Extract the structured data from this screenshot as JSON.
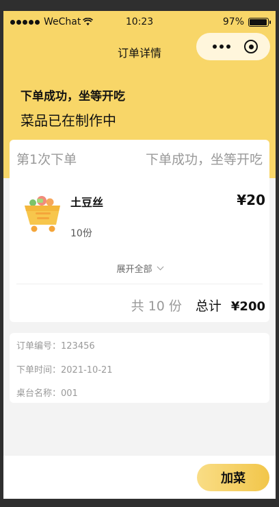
{
  "status_bar": {
    "carrier": "WeChat",
    "time": "10:23",
    "battery_text": "97%",
    "battery_level": 0.97
  },
  "nav": {
    "title": "订单详情",
    "more_icon": "more-dots-icon",
    "close_icon": "target-circle-icon"
  },
  "header": {
    "status": "下单成功，坐等开吃",
    "substatus": "菜品已在制作中"
  },
  "order_card": {
    "batch_label": "第1次下单",
    "batch_status": "下单成功，坐等开吃",
    "items": [
      {
        "name": "土豆丝",
        "quantity": "10份",
        "price": "¥20",
        "icon": "shopping-cart-icon"
      }
    ],
    "expand_label": "展开全部",
    "total_count": "共 10 份",
    "total_label": "总计",
    "total_value": "¥200"
  },
  "info": {
    "order_no": "订单编号：123456",
    "order_time": "下单时间：2021-10-21",
    "table_name": "桌台名称：001"
  },
  "bottom_bar": {
    "add_button": "加菜"
  },
  "colors": {
    "primary_yellow": "#f8d668",
    "capsule_bg": "#fff6dc",
    "button_gradient_start": "#f9dd86",
    "button_gradient_end": "#f2c64a"
  }
}
